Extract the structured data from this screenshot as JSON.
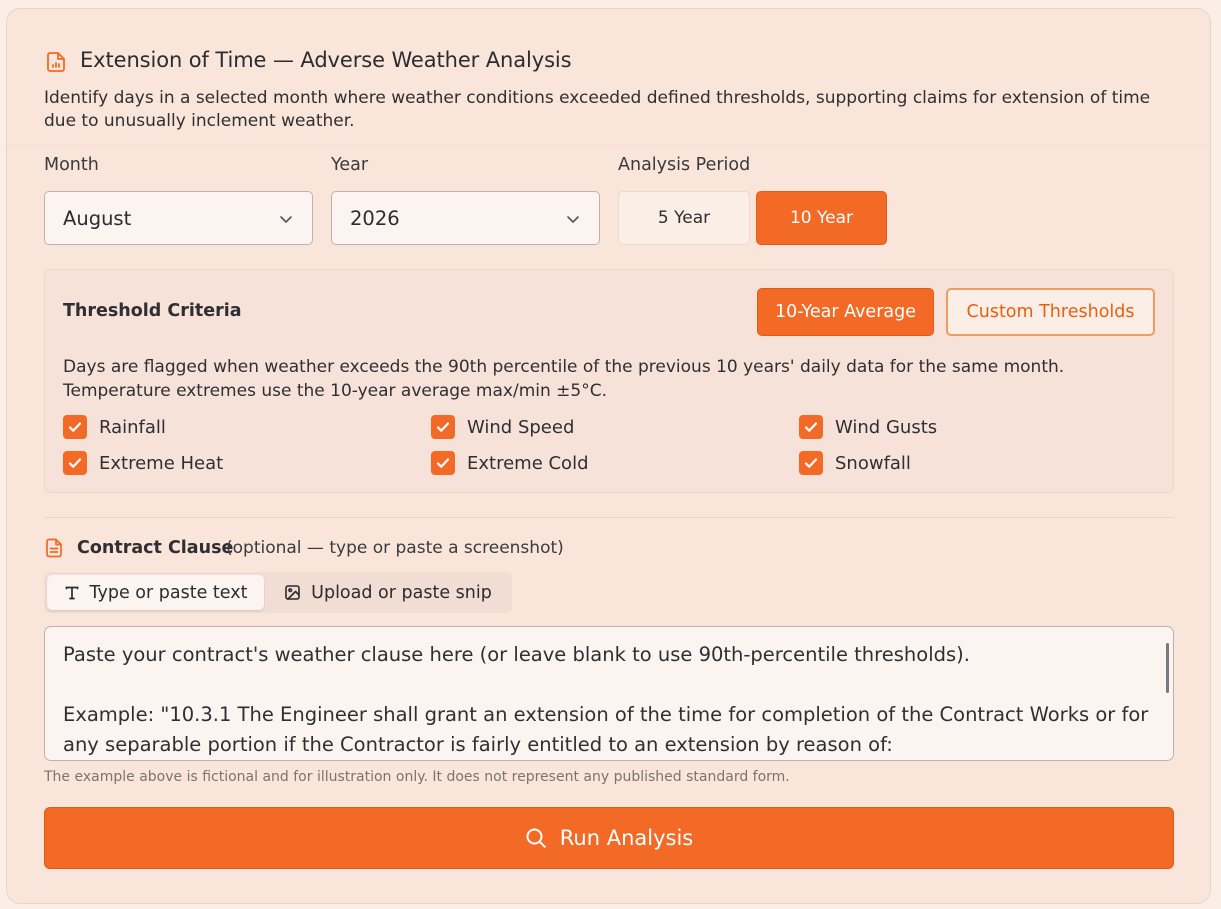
{
  "colors": {
    "accent": "#f26a25",
    "background": "#f9e5da",
    "checkbox": "#f26a25"
  },
  "header": {
    "icon": "chart-document-icon",
    "title": "Extension of Time — Adverse Weather Analysis",
    "description": "Identify days in a selected month where weather conditions exceeded defined thresholds, supporting claims for extension of time due to unusually inclement weather."
  },
  "fields": {
    "month": {
      "label": "Month",
      "value": "August"
    },
    "year": {
      "label": "Year",
      "value": "2026"
    },
    "period": {
      "label": "Analysis Period",
      "options": [
        "5 Year",
        "10 Year"
      ],
      "selected": "10 Year"
    }
  },
  "threshold": {
    "title": "Threshold Criteria",
    "mode_buttons": [
      "10-Year Average",
      "Custom Thresholds"
    ],
    "selected_mode": "10-Year Average",
    "description": "Days are flagged when weather exceeds the 90th percentile of the previous 10 years' daily data for the same month. Temperature extremes use the 10-year average max/min ±5°C.",
    "criteria": [
      {
        "label": "Rainfall",
        "checked": true
      },
      {
        "label": "Wind Speed",
        "checked": true
      },
      {
        "label": "Wind Gusts",
        "checked": true
      },
      {
        "label": "Extreme Heat",
        "checked": true
      },
      {
        "label": "Extreme Cold",
        "checked": true
      },
      {
        "label": "Snowfall",
        "checked": true
      }
    ]
  },
  "contract": {
    "title": "Contract Clause",
    "subtitle": "(optional — type or paste a screenshot)",
    "tabs": [
      {
        "label": "Type or paste text",
        "icon": "text-icon",
        "active": true
      },
      {
        "label": "Upload or paste snip",
        "icon": "image-icon",
        "active": false
      }
    ],
    "placeholder": "Paste your contract's weather clause here (or leave blank to use 90th-percentile thresholds).\n\nExample: \"10.3.1 The Engineer shall grant an extension of the time for completion of the Contract Works or for any separable portion if the Contractor is fairly entitled to an extension by reason of:",
    "note": "The example above is fictional and for illustration only. It does not represent any published standard form."
  },
  "actions": {
    "run_label": "Run Analysis"
  }
}
